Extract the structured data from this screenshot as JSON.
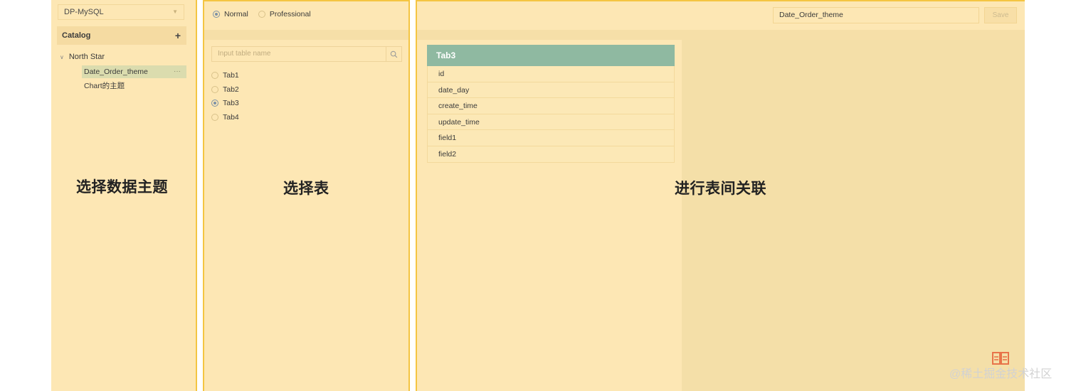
{
  "left_panel": {
    "datasource": "DP-MySQL",
    "catalog_label": "Catalog",
    "add_icon": "plus-icon",
    "tree": {
      "root": "North Star",
      "items": [
        {
          "label": "Date_Order_theme",
          "selected": true
        },
        {
          "label": "Chart的主题",
          "selected": false
        }
      ]
    },
    "caption": "选择数据主题"
  },
  "middle_panel": {
    "modes": [
      {
        "label": "Normal",
        "selected": true
      },
      {
        "label": "Professional",
        "selected": false
      }
    ],
    "search_placeholder": "Input table name",
    "tables": [
      {
        "label": "Tab1",
        "selected": false
      },
      {
        "label": "Tab2",
        "selected": false
      },
      {
        "label": "Tab3",
        "selected": true
      },
      {
        "label": "Tab4",
        "selected": false
      }
    ],
    "caption": "选择表"
  },
  "right_panel": {
    "theme_name_value": "Date_Order_theme",
    "save_label": "Save",
    "table_card": {
      "title": "Tab3",
      "fields": [
        "id",
        "date_day",
        "create_time",
        "update_time",
        "field1",
        "field2"
      ]
    },
    "caption": "进行表间关联"
  },
  "watermark": "@稀土掘金技术社区",
  "colors": {
    "panel_bg": "#fde7b4",
    "panel_border": "#f4c542",
    "card_header": "#8fb9a1",
    "selected_item": "#dbdcae"
  }
}
